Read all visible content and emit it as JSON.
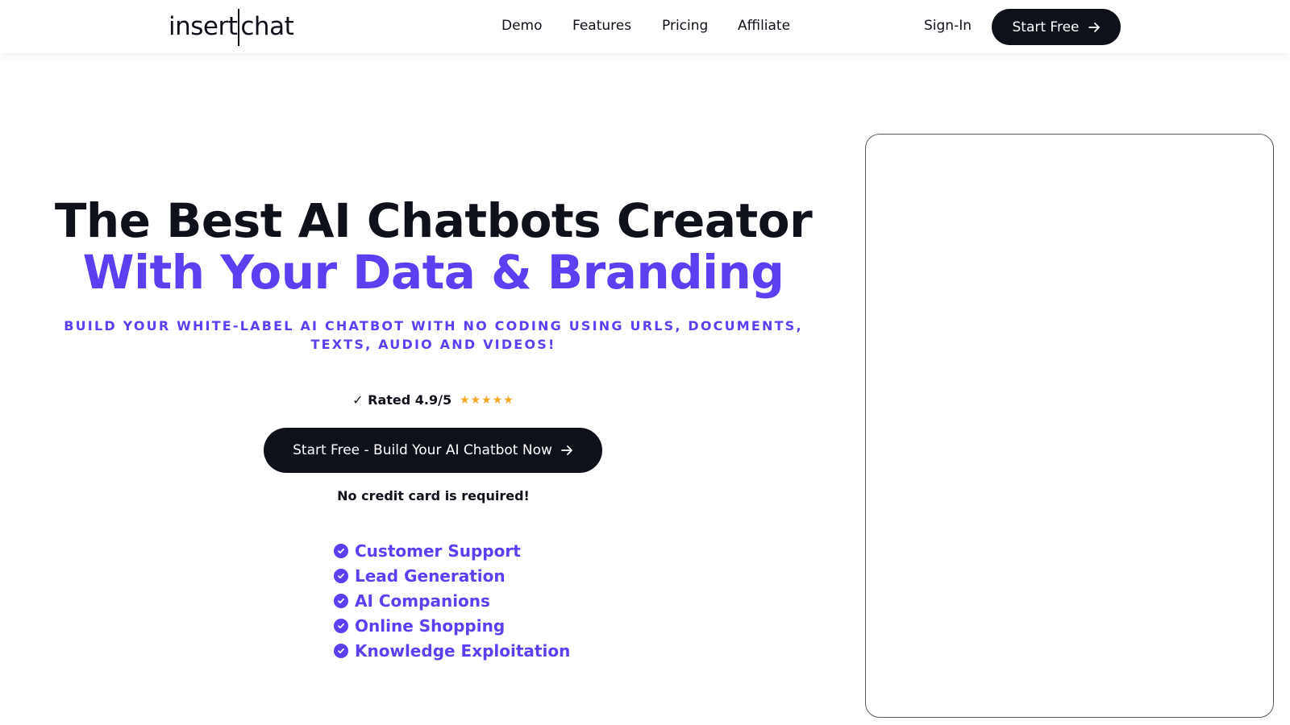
{
  "header": {
    "logo_left": "insert",
    "logo_right": "chat",
    "nav": [
      {
        "label": "Demo"
      },
      {
        "label": "Features"
      },
      {
        "label": "Pricing"
      },
      {
        "label": "Affiliate"
      }
    ],
    "signin_label": "Sign-In",
    "start_free_label": "Start Free"
  },
  "hero": {
    "title_line1": "The Best AI Chatbots Creator",
    "title_line2": "With Your Data & Branding",
    "subtitle": "BUILD YOUR WHITE-LABEL AI CHATBOT WITH NO CODING USING URLS, DOCUMENTS, TEXTS, AUDIO AND VIDEOS!",
    "rating_text": "✓ Rated 4.9/5",
    "stars": "★★★★★",
    "cta_label": "Start Free - Build Your AI Chatbot Now",
    "no_card_text": "No credit card is required!",
    "features": [
      "Customer Support",
      "Lead Generation",
      "AI Companions",
      "Online Shopping",
      "Knowledge Exploitation"
    ]
  },
  "colors": {
    "accent": "#5b3ff0",
    "dark": "#0f111a",
    "star": "#f5a623"
  }
}
